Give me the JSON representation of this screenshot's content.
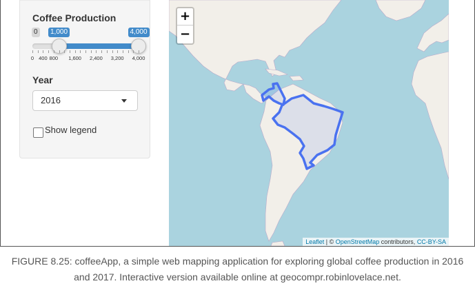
{
  "sidebar": {
    "slider": {
      "label": "Coffee Production",
      "min_label": "0",
      "low_value": "1,000",
      "high_value": "4,000",
      "min": 0,
      "max": 4000,
      "low": 1000,
      "high": 4000,
      "tick_labels": [
        "0",
        "400",
        "800",
        "1,600",
        "2,400",
        "3,200",
        "4,000"
      ],
      "tick_values": [
        0,
        400,
        800,
        1600,
        2400,
        3200,
        4000
      ],
      "accent_color": "#428bca"
    },
    "year": {
      "label": "Year",
      "selected": "2016"
    },
    "legend": {
      "label": "Show legend",
      "checked": false
    }
  },
  "map": {
    "zoom_in_label": "+",
    "zoom_out_label": "−",
    "attribution": {
      "leaflet": "Leaflet",
      "separator": " | © ",
      "osm": "OpenStreetMap",
      "contributors": " contributors, ",
      "license": "CC-BY-SA"
    },
    "colors": {
      "water": "#aad3df",
      "land": "#f2efe9",
      "highlight_stroke": "#4a72f0"
    }
  },
  "caption": {
    "line1": "FIGURE 8.25: coffeeApp, a simple web mapping application for exploring global coffee production in 2016",
    "line2": "and 2017. Interactive version available online at geocompr.robinlovelace.net."
  }
}
